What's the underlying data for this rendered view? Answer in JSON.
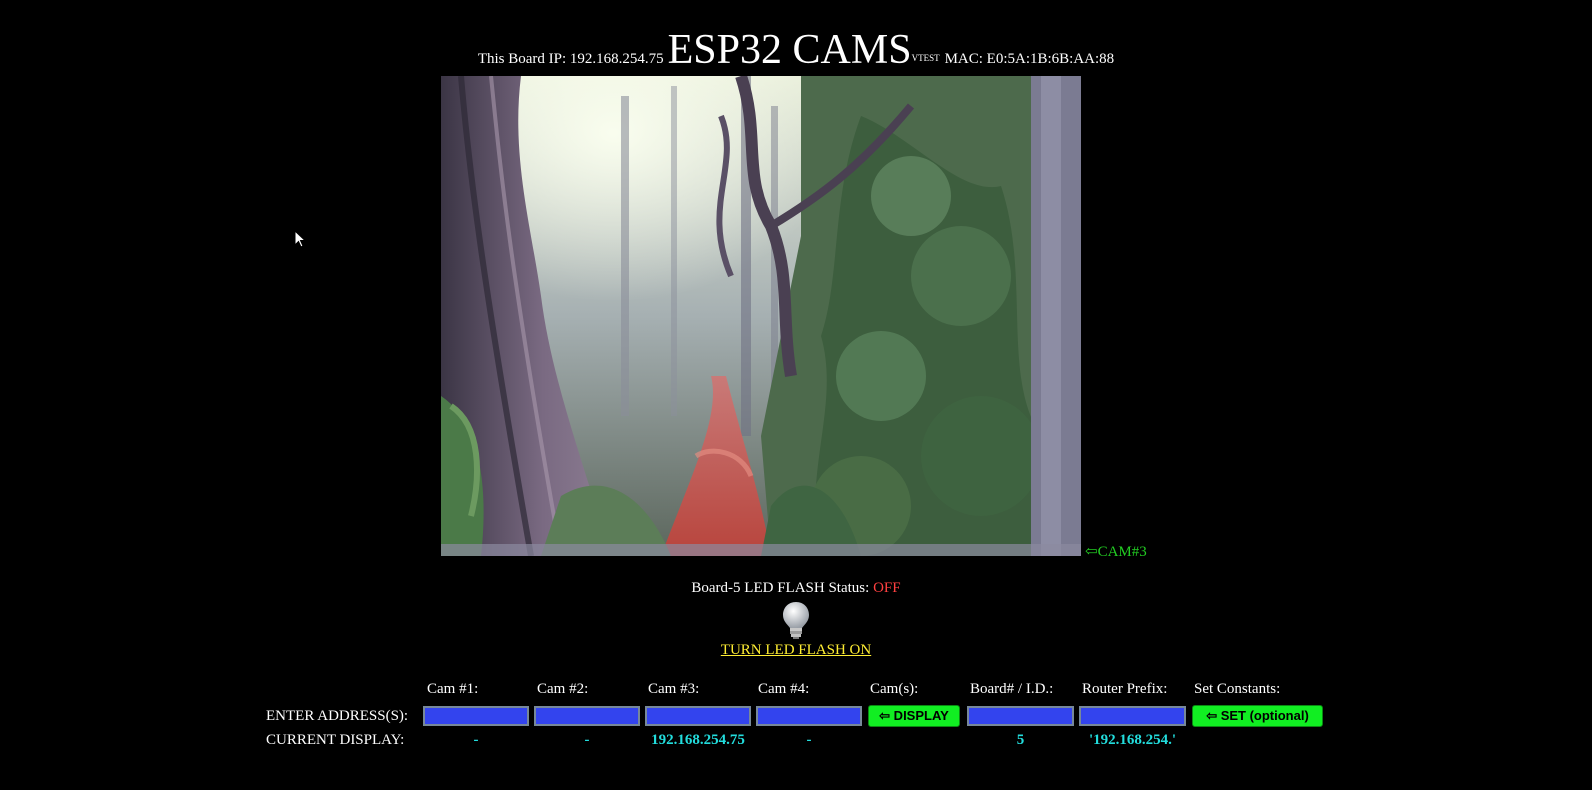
{
  "header": {
    "board_ip": "This Board IP: 192.168.254.75",
    "title": "ESP32 CAMS",
    "version": "VTEST",
    "mac": "MAC: E0:5A:1B:6B:AA:88"
  },
  "camera": {
    "label": "⇦CAM#3"
  },
  "flash": {
    "status_label": "Board-5 LED FLASH Status: ",
    "status_value": "OFF",
    "status_color": "#ff4040",
    "icon": "lightbulb-icon",
    "toggle_link": "TURN LED FLASH ON",
    "link_color": "#ffee33"
  },
  "form": {
    "enter_label": "ENTER ADDRESS(S):",
    "current_label": "CURRENT DISPLAY:",
    "headers": {
      "cam1": "Cam #1:",
      "cam2": "Cam #2:",
      "cam3": "Cam #3:",
      "cam4": "Cam #4:",
      "cams": "Cam(s):",
      "board": "Board# / I.D.:",
      "router": "Router Prefix:",
      "constants": "Set Constants:"
    },
    "inputs": {
      "cam1": "",
      "cam2": "",
      "cam3": "",
      "cam4": "",
      "board": "",
      "router": ""
    },
    "display_button": "⇦ DISPLAY",
    "set_button": "⇦ SET (optional)",
    "current": {
      "cam1": "-",
      "cam2": "-",
      "cam3": "192.168.254.75",
      "cam4": "-",
      "board": "5",
      "router": "'192.168.254.'"
    },
    "colors": {
      "input_bg": "#3344ee",
      "button_bg": "#11ee22",
      "value_color": "#22dddd"
    }
  }
}
